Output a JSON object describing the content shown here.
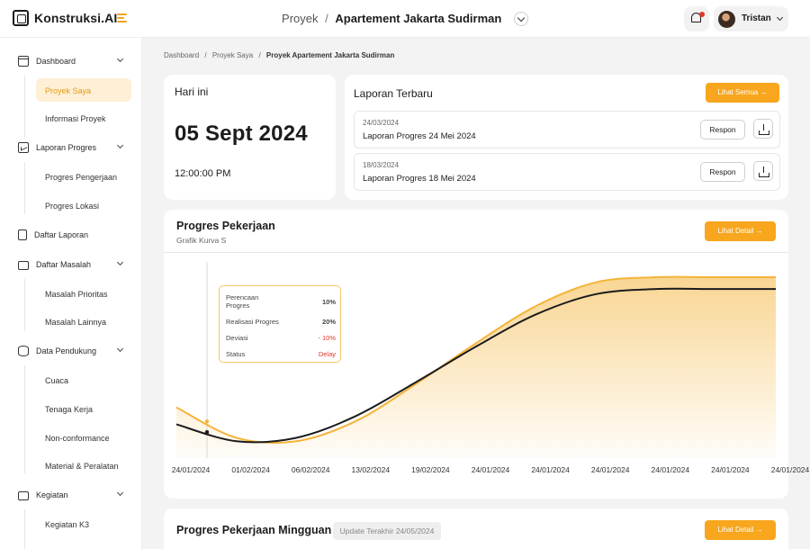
{
  "app": {
    "name": "Konstruksi.AI"
  },
  "header": {
    "project_prefix": "Proyek",
    "separator": "/",
    "project_name": "Apartement Jakarta Sudirman",
    "user_name": "Tristan"
  },
  "sidebar": {
    "dashboard": "Dashboard",
    "proyek_saya": "Proyek Saya",
    "informasi_proyek": "Informasi Proyek",
    "laporan_progres": "Laporan Progres",
    "progres_pengerjaan": "Progres Pengerjaan",
    "progres_lokasi": "Progres Lokasi",
    "daftar_laporan": "Daftar Laporan",
    "daftar_masalah": "Daftar Masalah",
    "masalah_prioritas": "Masalah Prioritas",
    "masalah_lainnya": "Masalah Lainnya",
    "data_pendukung": "Data Pendukung",
    "cuaca": "Cuaca",
    "tenaga_kerja": "Tenaga Kerja",
    "non_conformance": "Non-conformance",
    "material": "Material & Peralatan",
    "kegiatan": "Kegiatan",
    "kegiatan_k3": "Kegiatan K3"
  },
  "breadcrumb": {
    "a": "Dashboard",
    "b": "Proyek Saya",
    "c": "Proyek Apartement Jakarta Sudirman"
  },
  "today": {
    "title": "Hari ini",
    "date": "05 Sept 2024",
    "time": "12:00:00 PM"
  },
  "reports": {
    "title": "Laporan Terbaru",
    "see_all": "Lihat Semua →",
    "respon": "Respon",
    "items": [
      {
        "date": "24/03/2024",
        "name": "Laporan Progres 24 Mei 2024"
      },
      {
        "date": "18/03/2024",
        "name": "Laporan Progres 18 Mei 2024"
      }
    ]
  },
  "progress": {
    "title": "Progres Pekerjaan",
    "subtitle": "Grafik Kurva S",
    "detail": "Lihat Detail →",
    "tooltip": {
      "plan_label": "Perencaan Progres",
      "plan_value": "10%",
      "real_label": "Realisasi Progres",
      "real_value": "20%",
      "dev_label": "Deviasi",
      "dev_value": "- 10%",
      "status_label": "Status",
      "status_value": "Delay"
    }
  },
  "weekly": {
    "title": "Progres Pekerjaan Mingguan",
    "updated": "Update Terakhir 24/05/2024",
    "detail": "Lihat Detail →"
  },
  "chart_data": {
    "type": "line",
    "x": [
      "24/01/2024",
      "01/02/2024",
      "06/02/2024",
      "13/02/2024",
      "19/02/2024",
      "24/01/2024",
      "24/01/2024",
      "24/01/2024",
      "24/01/2024",
      "24/01/2024",
      "24/01/2024"
    ],
    "series": [
      {
        "values": [
          20,
          10,
          12,
          25,
          45,
          66,
          85,
          97,
          100,
          100,
          100
        ],
        "color": "#1c1c1c"
      },
      {
        "values": [
          30,
          12,
          10,
          22,
          44,
          68,
          90,
          104,
          107,
          107,
          107
        ],
        "color": "#f4b43a"
      }
    ],
    "ylim": [
      0,
      115
    ],
    "grid": false,
    "colors": {
      "accent": "#f7a61d",
      "danger": "#e0362c"
    }
  }
}
